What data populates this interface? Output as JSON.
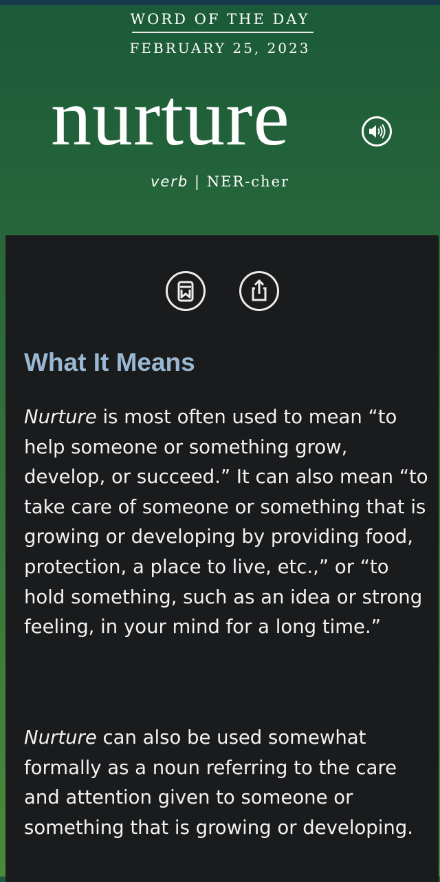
{
  "header": {
    "eyebrow": "WORD OF THE DAY",
    "date": "FEBRUARY 25, 2023",
    "word": "nurture",
    "part_of_speech": "verb",
    "separator": " | ",
    "pronunciation": "NER-cher"
  },
  "actions": {
    "audio_icon": "speaker-icon",
    "save_icon": "bookmark-icon",
    "share_icon": "share-icon"
  },
  "definition": {
    "heading": "What It Means",
    "paragraph1": {
      "term": "Nurture",
      "text": " is most often used to mean “to help someone or something grow, develop, or succeed.” It can also mean “to take care of someone or something that is growing or developing by providing food, protection, a place to live, etc.,” or “to hold something, such as an idea or strong feeling, in your mind for a long time.”"
    },
    "paragraph2": {
      "term": "Nurture",
      "text": " can also be used somewhat formally as a noun referring to the care and attention given to someone or something that is growing or developing."
    }
  },
  "colors": {
    "header_green": "#1b5a38",
    "card_bg": "#1a1b1d",
    "heading_blue": "#9ab8d3",
    "top_bar": "#163a4c"
  }
}
